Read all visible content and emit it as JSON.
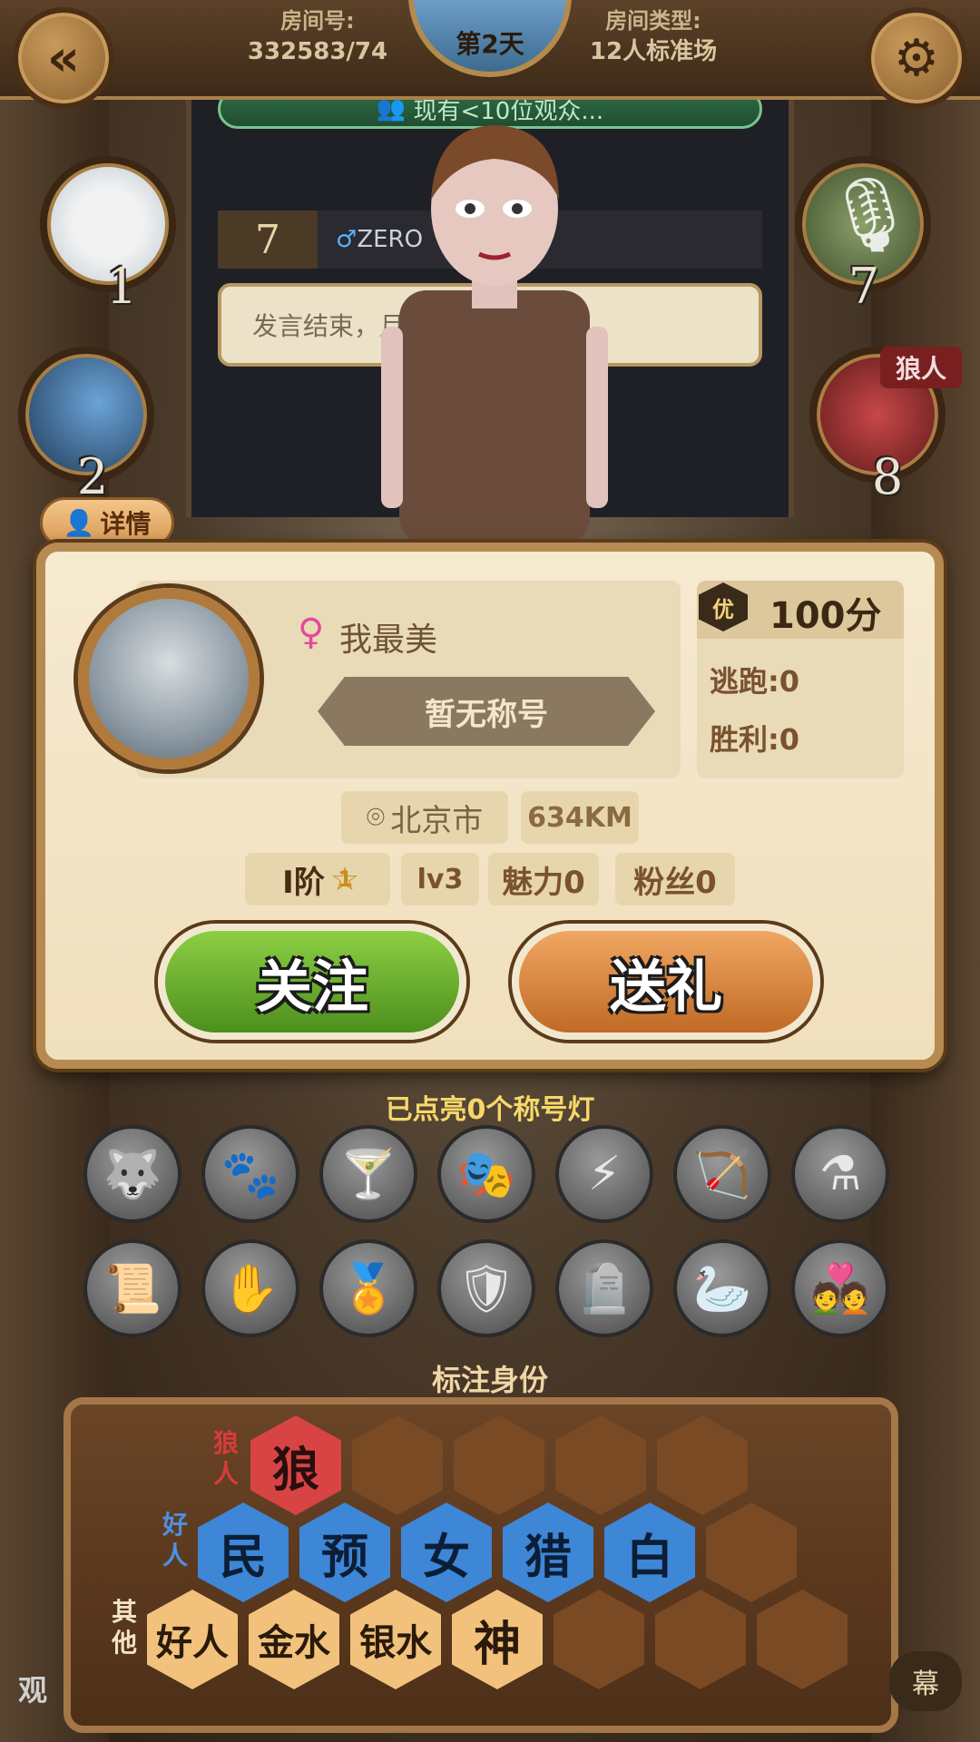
{
  "header": {
    "room_number_label": "房间号:",
    "room_number": "332583/74",
    "day": "第2天",
    "room_type_label": "房间类型:",
    "room_type": "12人标准场"
  },
  "chat": {
    "watchers": "现有<10位观众...",
    "speaker_number": "7",
    "speaker_name": "ZERO",
    "message": "发言结束，月"
  },
  "seats": {
    "seat_1": "1",
    "seat_2": "2",
    "seat_7": "7",
    "seat_8": "8",
    "wolf_tag": "狼人"
  },
  "detail_tag": "详情",
  "profile": {
    "nickname": "我最美",
    "title": "暂无称号",
    "score_badge": "优",
    "score": "100分",
    "escape": "逃跑:0",
    "wins": "胜利:0",
    "city": "北京市",
    "distance": "634KM",
    "rank": "I阶",
    "rank_star": "1",
    "level": "lv3",
    "charm": "魅力0",
    "fans": "粉丝0"
  },
  "actions": {
    "follow": "关注",
    "gift": "送礼"
  },
  "title_lights": {
    "label": "已点亮0个称号灯",
    "icons": [
      "wolf-icon",
      "werewolf-icon",
      "potion-icon",
      "mask-icon",
      "claw-icon",
      "crossbow-icon",
      "bottles-icon",
      "scroll-icon",
      "glove-icon",
      "medal-icon",
      "shield-sword-icon",
      "tombstone-icon",
      "swan-icon",
      "couple-icon"
    ]
  },
  "identity": {
    "label": "标注身份",
    "wolf_row_label": "狼人",
    "good_row_label": "好人",
    "other_row_label": "其他",
    "wolf_roles": [
      "狼"
    ],
    "good_roles": [
      "民",
      "预",
      "女",
      "猎",
      "白"
    ],
    "other_roles": [
      "好人",
      "金水",
      "银水",
      "神"
    ]
  },
  "bottom": {
    "left_text": "观",
    "right_button": "幕"
  },
  "colors": {
    "follow_green": "#6bb030",
    "gift_orange": "#dc8a44",
    "wolf_red": "#d84444",
    "good_blue": "#3e86d6",
    "other_tan": "#f2c27c"
  }
}
